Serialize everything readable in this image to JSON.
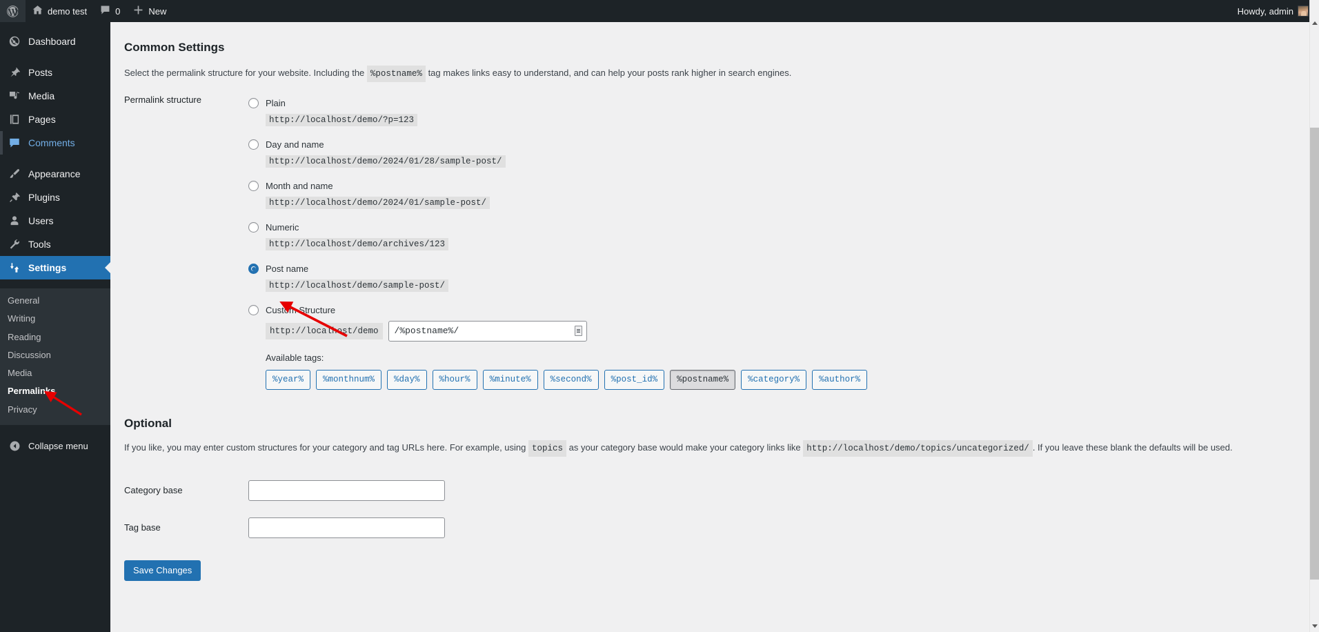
{
  "adminbar": {
    "logo_icon": "wordpress-logo-icon",
    "site_icon": "home-icon",
    "site_name": "demo test",
    "comments_icon": "comment-bubble-icon",
    "comments_count": "0",
    "new_icon": "plus-icon",
    "new_label": "New",
    "howdy": "Howdy, admin",
    "avatar_name": "user-avatar"
  },
  "sidebar": {
    "items": [
      {
        "label": "Dashboard",
        "icon": "dashboard-icon",
        "state": "normal"
      },
      {
        "label": "Posts",
        "icon": "pin-icon",
        "state": "normal"
      },
      {
        "label": "Media",
        "icon": "media-icon",
        "state": "normal"
      },
      {
        "label": "Pages",
        "icon": "pages-icon",
        "state": "normal"
      },
      {
        "label": "Comments",
        "icon": "comment-bubble-icon",
        "state": "highlight"
      },
      {
        "label": "Appearance",
        "icon": "brush-icon",
        "state": "normal"
      },
      {
        "label": "Plugins",
        "icon": "plug-icon",
        "state": "normal"
      },
      {
        "label": "Users",
        "icon": "user-icon",
        "state": "normal"
      },
      {
        "label": "Tools",
        "icon": "wrench-icon",
        "state": "normal"
      },
      {
        "label": "Settings",
        "icon": "sliders-icon",
        "state": "current"
      }
    ],
    "submenu": [
      {
        "label": "General",
        "current": false
      },
      {
        "label": "Writing",
        "current": false
      },
      {
        "label": "Reading",
        "current": false
      },
      {
        "label": "Discussion",
        "current": false
      },
      {
        "label": "Media",
        "current": false
      },
      {
        "label": "Permalinks",
        "current": true
      },
      {
        "label": "Privacy",
        "current": false
      }
    ],
    "collapse": {
      "label": "Collapse menu",
      "icon": "chevron-left-circle-icon"
    },
    "accent_color": "#2271b1",
    "background_color": "#1d2327",
    "submenu_background": "#2c3338"
  },
  "main": {
    "common_settings_title": "Common Settings",
    "common_settings_desc_1": "Select the permalink structure for your website. Including the",
    "common_settings_code": "%postname%",
    "common_settings_desc_2": "tag makes links easy to understand, and can help your posts rank higher in search engines.",
    "permalink_structure_label": "Permalink structure",
    "options": [
      {
        "label": "Plain",
        "example": "http://localhost/demo/?p=123",
        "selected": false
      },
      {
        "label": "Day and name",
        "example": "http://localhost/demo/2024/01/28/sample-post/",
        "selected": false
      },
      {
        "label": "Month and name",
        "example": "http://localhost/demo/2024/01/sample-post/",
        "selected": false
      },
      {
        "label": "Numeric",
        "example": "http://localhost/demo/archives/123",
        "selected": false
      },
      {
        "label": "Post name",
        "example": "http://localhost/demo/sample-post/",
        "selected": true
      }
    ],
    "custom_structure": {
      "label": "Custom Structure",
      "selected": false,
      "prefix": "http://localhost/demo",
      "value": "/%postname%/",
      "handle_icon": "resize-handle-icon"
    },
    "available_tags_label": "Available tags:",
    "tags": [
      {
        "label": "%year%",
        "pressed": false
      },
      {
        "label": "%monthnum%",
        "pressed": false
      },
      {
        "label": "%day%",
        "pressed": false
      },
      {
        "label": "%hour%",
        "pressed": false
      },
      {
        "label": "%minute%",
        "pressed": false
      },
      {
        "label": "%second%",
        "pressed": false
      },
      {
        "label": "%post_id%",
        "pressed": false
      },
      {
        "label": "%postname%",
        "pressed": true
      },
      {
        "label": "%category%",
        "pressed": false
      },
      {
        "label": "%author%",
        "pressed": false
      }
    ],
    "optional_title": "Optional",
    "optional_desc_1": "If you like, you may enter custom structures for your category and tag URLs here. For example, using",
    "optional_code_1": "topics",
    "optional_desc_2": "as your category base would make your category links like",
    "optional_code_2": "http://localhost/demo/topics/uncategorized/",
    "optional_desc_3": ". If you leave these blank the defaults will be used.",
    "category_base_label": "Category base",
    "category_base_value": "",
    "tag_base_label": "Tag base",
    "tag_base_value": "",
    "save_label": "Save Changes",
    "accent_color": "#2271b1"
  },
  "annotations": {
    "arrow_color": "#e60000",
    "arrow_permalinks": "arrow-pointing-to-permalinks",
    "arrow_postname": "arrow-pointing-to-post-name-example"
  },
  "scrollbar": {
    "up_icon": "scroll-up-arrow-icon",
    "down_icon": "scroll-down-arrow-icon",
    "thumb_name": "scroll-thumb"
  }
}
